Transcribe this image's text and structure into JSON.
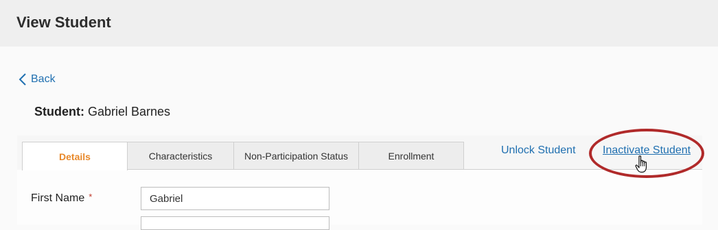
{
  "header": {
    "title": "View Student"
  },
  "back": {
    "label": "Back"
  },
  "student": {
    "label": "Student:",
    "name": "Gabriel Barnes"
  },
  "tabs": [
    {
      "label": "Details",
      "active": true
    },
    {
      "label": "Characteristics",
      "active": false
    },
    {
      "label": "Non-Participation Status",
      "active": false
    },
    {
      "label": "Enrollment",
      "active": false
    }
  ],
  "actions": {
    "unlock": "Unlock Student",
    "inactivate": "Inactivate Student"
  },
  "form": {
    "first_name": {
      "label": "First Name",
      "required_mark": "*",
      "value": "Gabriel"
    },
    "next_field": {
      "value": ""
    }
  },
  "colors": {
    "link": "#1f6fb0",
    "active_tab": "#e8892b",
    "highlight": "#b02a2a",
    "required": "#c0392b"
  },
  "icons": {
    "back": "chevron-left-icon",
    "cursor": "hand-pointer-icon"
  }
}
